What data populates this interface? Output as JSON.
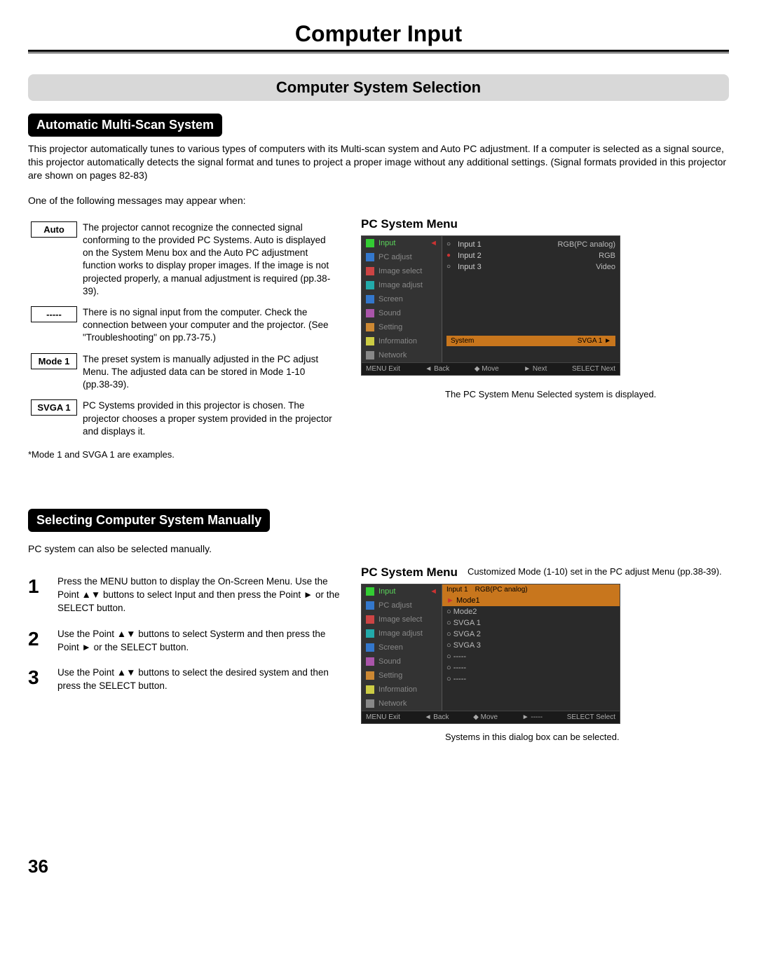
{
  "page_title": "Computer Input",
  "section_banner": "Computer System Selection",
  "auto_section": {
    "heading": "Automatic Multi-Scan System",
    "intro": "This projector automatically tunes to various types of computers with its Multi-scan system and Auto PC adjustment. If a computer is selected as a signal source, this projector automatically detects the signal format and tunes to project a proper image without any additional settings. (Signal formats provided in this projector are shown on pages 82-83)",
    "msg_intro": "One of the following messages may appear when:",
    "rows": [
      {
        "label": "Auto",
        "desc": "The projector cannot recognize the connected signal conforming to the provided PC Systems. Auto is displayed on the System Menu box and the Auto PC adjustment function works to display proper images. If the image is not projected properly, a manual adjustment is required (pp.38-39)."
      },
      {
        "label": "-----",
        "desc": "There is no signal input from the computer. Check the connection between your computer and the projector. (See \"Troubleshooting\" on pp.73-75.)"
      },
      {
        "label": "Mode 1",
        "desc": "The preset system is manually adjusted in the PC adjust Menu. The adjusted data can be stored in Mode 1-10 (pp.38-39)."
      },
      {
        "label": "SVGA 1",
        "desc": "PC Systems provided in this projector is chosen. The projector chooses a proper system provided in the projector and displays it."
      }
    ],
    "footnote": "*Mode 1 and SVGA 1 are examples."
  },
  "pc_menu_1": {
    "heading": "PC System Menu",
    "side_items": [
      "Input",
      "PC adjust",
      "Image select",
      "Image adjust",
      "Screen",
      "Sound",
      "Setting",
      "Information",
      "Network"
    ],
    "main_rows": [
      {
        "dot": "on",
        "label": "Input 1",
        "val": "RGB(PC analog)"
      },
      {
        "dot": "sel",
        "label": "Input 2",
        "val": "RGB"
      },
      {
        "dot": "on",
        "label": "Input 3",
        "val": "Video"
      }
    ],
    "subbar_left": "System",
    "subbar_right": "SVGA 1 ►",
    "footer": [
      "MENU Exit",
      "◄ Back",
      "◆ Move",
      "► Next",
      "SELECT Next"
    ],
    "caption": "The PC System Menu Selected system is displayed."
  },
  "manual_section": {
    "heading": "Selecting Computer System Manually",
    "intro": "PC system can also be selected manually.",
    "steps": [
      "Press the MENU button to display the On-Screen Menu. Use the Point ▲▼ buttons to select Input and then press the Point ► or the SELECT button.",
      "Use the Point ▲▼ buttons to select Systerm and then press the Point ► or the SELECT button.",
      "Use the Point ▲▼ buttons to select the desired system and then press the SELECT button."
    ]
  },
  "pc_menu_2": {
    "heading": "PC System Menu",
    "top_caption": "Customized Mode (1-10) set in the PC adjust Menu (pp.38-39).",
    "topbar": [
      "Input 1",
      "RGB(PC analog)"
    ],
    "side_items": [
      "Input",
      "PC adjust",
      "Image select",
      "Image adjust",
      "Screen",
      "Sound",
      "Setting",
      "Information",
      "Network"
    ],
    "list": [
      "Mode1",
      "Mode2",
      "SVGA 1",
      "SVGA 2",
      "SVGA 3",
      "-----",
      "-----",
      "-----"
    ],
    "footer": [
      "MENU Exit",
      "◄ Back",
      "◆ Move",
      "► -----",
      "SELECT Select"
    ],
    "caption": "Systems in this dialog box can be selected."
  },
  "page_number": "36"
}
